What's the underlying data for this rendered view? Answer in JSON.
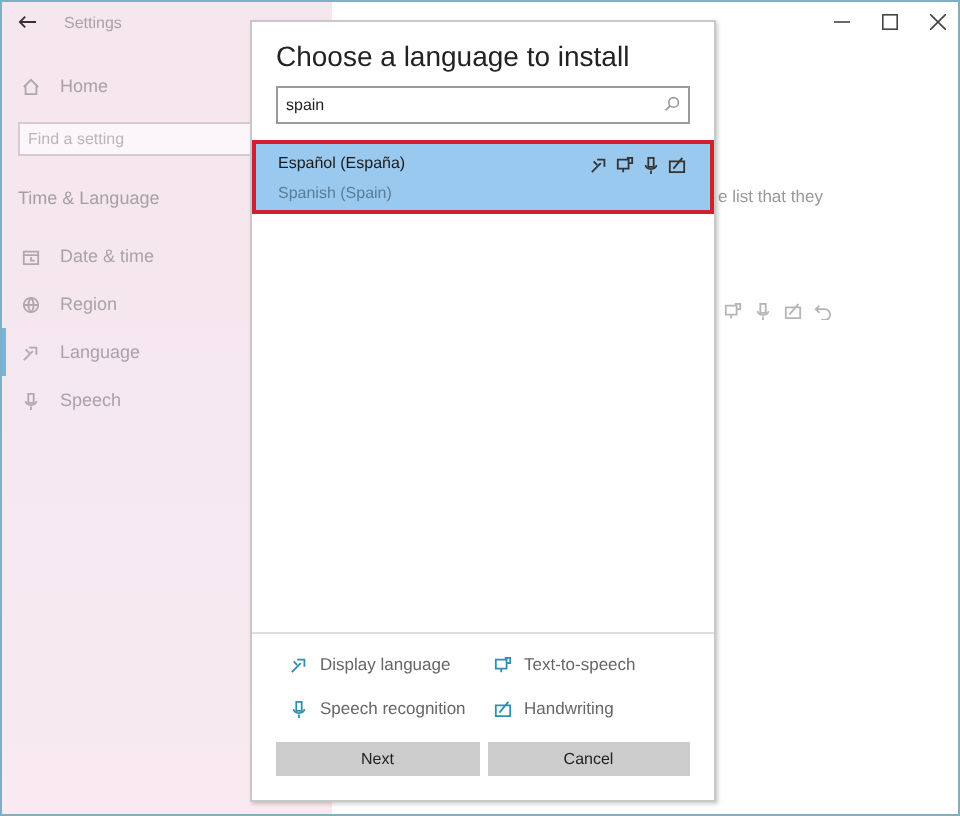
{
  "window": {
    "title": "Settings"
  },
  "sidebar": {
    "home": "Home",
    "search": {
      "placeholder": "Find a setting"
    },
    "section": "Time & Language",
    "items": [
      {
        "label": "Date & time",
        "selected": false
      },
      {
        "label": "Region",
        "selected": false
      },
      {
        "label": "Language",
        "selected": true
      },
      {
        "label": "Speech",
        "selected": false
      }
    ]
  },
  "content": {
    "text": "e list that they",
    "features": [
      {
        "kind": "tts"
      },
      {
        "kind": "speech"
      },
      {
        "kind": "handwriting"
      },
      {
        "kind": "undo"
      }
    ]
  },
  "dialog": {
    "title": "Choose a language to install",
    "search": {
      "value": "spain"
    },
    "languages": [
      {
        "name": "Español (España)",
        "english": "Spanish (Spain)",
        "selected": true,
        "features": [
          {
            "kind": "display"
          },
          {
            "kind": "tts"
          },
          {
            "kind": "speech"
          },
          {
            "kind": "handwriting"
          }
        ]
      }
    ],
    "legend": [
      {
        "kind": "display",
        "label": "Display language"
      },
      {
        "kind": "tts",
        "label": "Text-to-speech"
      },
      {
        "kind": "speech",
        "label": "Speech recognition"
      },
      {
        "kind": "handwriting",
        "label": "Handwriting"
      }
    ],
    "buttons": [
      "Next",
      "Cancel"
    ]
  }
}
